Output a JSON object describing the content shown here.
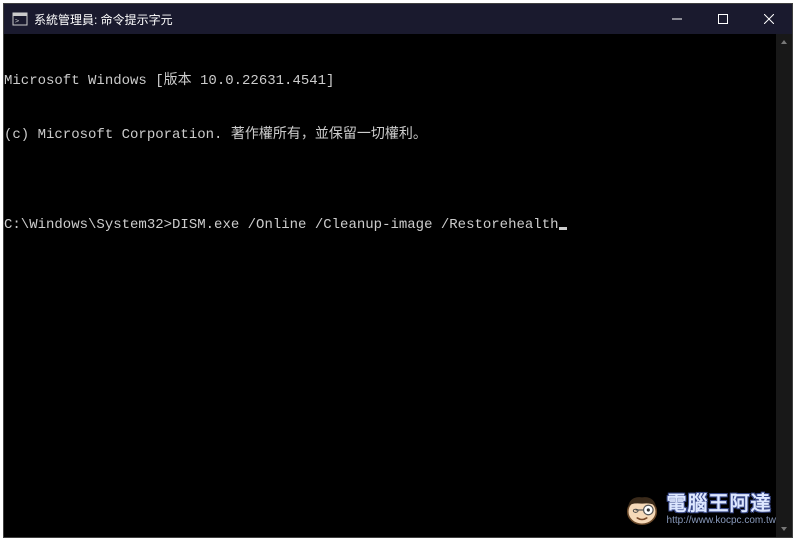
{
  "titlebar": {
    "icon_label": "cmd-icon",
    "title": "系統管理員: 命令提示字元"
  },
  "controls": {
    "minimize_label": "Minimize",
    "maximize_label": "Maximize",
    "close_label": "Close"
  },
  "terminal": {
    "line1": "Microsoft Windows [版本 10.0.22631.4541]",
    "line2": "(c) Microsoft Corporation. 著作權所有，並保留一切權利。",
    "blank": "",
    "prompt": "C:\\Windows\\System32>",
    "command": "DISM.exe /Online /Cleanup-image /Restorehealth"
  },
  "watermark": {
    "text_cn": "電腦王阿達",
    "text_url": "http://www.kocpc.com.tw"
  }
}
